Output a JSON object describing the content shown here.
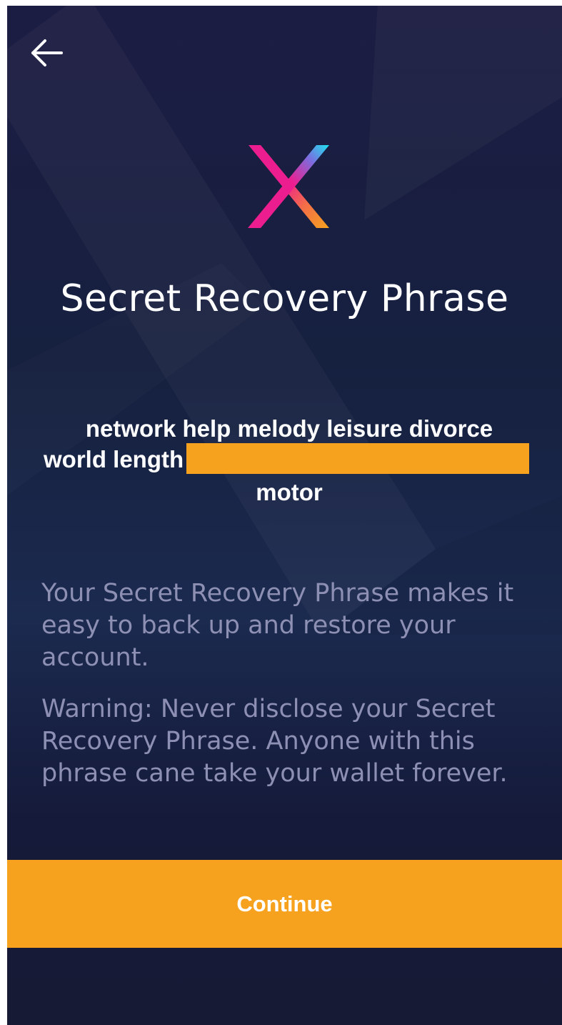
{
  "header": {
    "back_icon": "arrow-left-icon"
  },
  "logo": {
    "icon": "x-logo-icon",
    "colors": [
      "#ec1e8f",
      "#1de3ef",
      "#f6a21e"
    ]
  },
  "title": "Secret Recovery Phrase",
  "phrase": {
    "line1": "network help melody leisure divorce",
    "line2_visible": "world length",
    "line3": "motor",
    "redaction_color": "#f6a21e"
  },
  "description": {
    "info": "Your Secret Recovery Phrase makes it easy to back up and restore your account.",
    "warning": "Warning: Never disclose your Secret Recovery Phrase. Anyone with this phrase cane take your wallet forever."
  },
  "continue_label": "Continue",
  "colors": {
    "accent": "#f6a21e",
    "background": "#16203f",
    "muted_text": "#8d8fb3"
  }
}
